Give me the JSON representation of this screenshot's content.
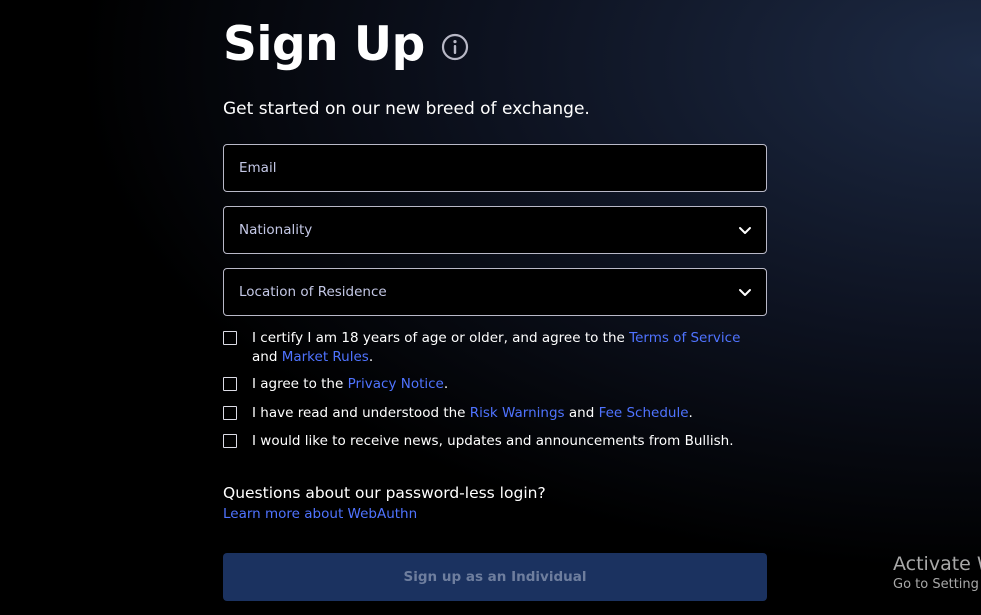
{
  "header": {
    "title": "Sign Up"
  },
  "subtitle": "Get started on our new breed of exchange.",
  "fields": {
    "email": {
      "placeholder": "Email"
    },
    "nationality": {
      "placeholder": "Nationality"
    },
    "residence": {
      "placeholder": "Location of Residence"
    }
  },
  "checks": {
    "age": {
      "prefix": "I certify I am 18 years of age or older, and agree to the ",
      "link1": "Terms of Service",
      "mid": " and ",
      "link2": "Market Rules",
      "suffix": "."
    },
    "privacy": {
      "prefix": "I agree to the ",
      "link1": "Privacy Notice",
      "suffix": "."
    },
    "risk": {
      "prefix": "I have read and understood the ",
      "link1": "Risk Warnings",
      "mid": " and ",
      "link2": "Fee Schedule",
      "suffix": "."
    },
    "news": {
      "text": "I would like to receive news, updates and announcements from Bullish."
    }
  },
  "help": {
    "question": "Questions about our password-less login?",
    "link": "Learn more about WebAuthn"
  },
  "submit": {
    "label": "Sign up as an Individual"
  },
  "watermark": {
    "line1": "Activate W",
    "line2": "Go to Setting"
  },
  "colors": {
    "link": "#4f73ff",
    "button_bg": "#1b3260",
    "button_text": "#6e7e9e"
  }
}
